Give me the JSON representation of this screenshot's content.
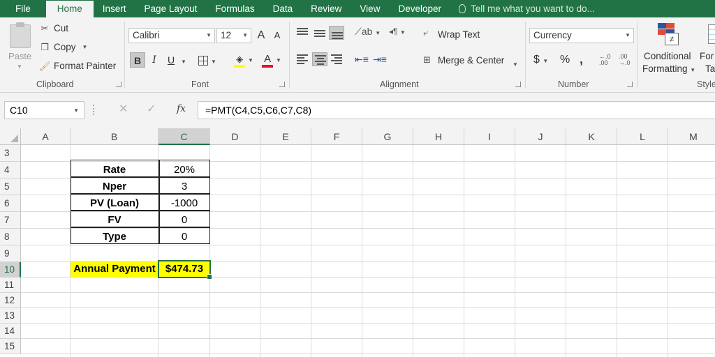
{
  "ribbon_tabs": [
    "File",
    "Home",
    "Insert",
    "Page Layout",
    "Formulas",
    "Data",
    "Review",
    "View",
    "Developer"
  ],
  "tell_me": "Tell me what you want to do...",
  "clipboard": {
    "paste": "Paste",
    "cut": "Cut",
    "copy": "Copy",
    "format_painter": "Format Painter",
    "label": "Clipboard"
  },
  "font": {
    "name": "Calibri",
    "size": "12",
    "label": "Font",
    "grow": "A",
    "shrink": "A",
    "bold": "B",
    "italic": "I",
    "underline": "U",
    "color_letter": "A"
  },
  "alignment": {
    "wrap_text": "Wrap Text",
    "merge_center": "Merge & Center",
    "label": "Alignment"
  },
  "number": {
    "format": "Currency",
    "dollar": "$",
    "percent": "%",
    "comma": ",",
    "label": "Number"
  },
  "styles": {
    "conditional": "Conditional",
    "formatting": "Formatting",
    "format_as": "For",
    "table": "Ta",
    "label": "Style"
  },
  "formula_bar": {
    "name_box": "C10",
    "fx": "fx",
    "formula": "=PMT(C4,C5,C6,C7,C8)"
  },
  "columns": [
    "A",
    "B",
    "C",
    "D",
    "E",
    "F",
    "G",
    "H",
    "I",
    "J",
    "K",
    "L",
    "M"
  ],
  "rows": [
    "3",
    "4",
    "5",
    "6",
    "7",
    "8",
    "9",
    "10",
    "11",
    "12",
    "13",
    "14",
    "15"
  ],
  "table": [
    {
      "label": "Rate",
      "value": "20%"
    },
    {
      "label": "Nper",
      "value": "3"
    },
    {
      "label": "PV (Loan)",
      "value": "-1000"
    },
    {
      "label": "FV",
      "value": "0"
    },
    {
      "label": "Type",
      "value": "0"
    }
  ],
  "result": {
    "label": "Annual Payment",
    "value": "$474.73"
  },
  "colors": {
    "excel_green": "#217346",
    "highlight": "#ffff00",
    "font_color": "#e81123"
  }
}
